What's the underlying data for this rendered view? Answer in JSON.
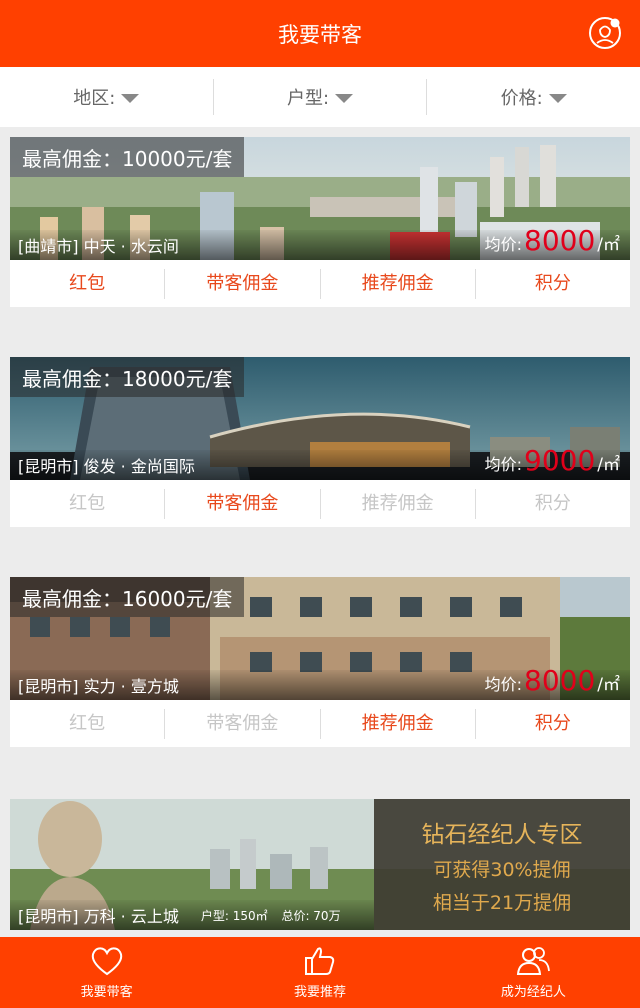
{
  "header": {
    "title": "我要带客"
  },
  "filters": [
    {
      "label": "地区:"
    },
    {
      "label": "户型:"
    },
    {
      "label": "价格:"
    }
  ],
  "listings": [
    {
      "commission": "最高佣金：10000元/套",
      "name": "[曲靖市] 中天 · 水云间",
      "price_label": "均价:",
      "price": "8000",
      "price_unit": "/㎡",
      "actions": [
        {
          "label": "红包",
          "active": true
        },
        {
          "label": "带客佣金",
          "active": true
        },
        {
          "label": "推荐佣金",
          "active": true
        },
        {
          "label": "积分",
          "active": true
        }
      ]
    },
    {
      "commission": "最高佣金：18000元/套",
      "name": "[昆明市] 俊发 · 金尚国际",
      "price_label": "均价:",
      "price": "9000",
      "price_unit": "/㎡",
      "actions": [
        {
          "label": "红包",
          "active": false
        },
        {
          "label": "带客佣金",
          "active": true
        },
        {
          "label": "推荐佣金",
          "active": false
        },
        {
          "label": "积分",
          "active": false
        }
      ]
    },
    {
      "commission": "最高佣金：16000元/套",
      "name": "[昆明市] 实力 · 壹方城",
      "price_label": "均价:",
      "price": "8000",
      "price_unit": "/㎡",
      "actions": [
        {
          "label": "红包",
          "active": false
        },
        {
          "label": "带客佣金",
          "active": false
        },
        {
          "label": "推荐佣金",
          "active": true
        },
        {
          "label": "积分",
          "active": true
        }
      ]
    }
  ],
  "promo": {
    "title": "钻石经纪人专区",
    "line1": "可获得30%提佣",
    "line2": "相当于21万提佣",
    "name": "[昆明市] 万科 · 云上城",
    "layout": "户型: 150㎡",
    "total": "总价: 70万"
  },
  "tabbar": [
    {
      "label": "我要带客",
      "icon": "heart-icon"
    },
    {
      "label": "我要推荐",
      "icon": "thumbs-up-icon"
    },
    {
      "label": "成为经纪人",
      "icon": "users-icon"
    }
  ],
  "colors": {
    "brand": "#ff4000",
    "price": "#e0001a",
    "active_action": "#e8491d",
    "inactive_action": "#c6c6c6"
  }
}
